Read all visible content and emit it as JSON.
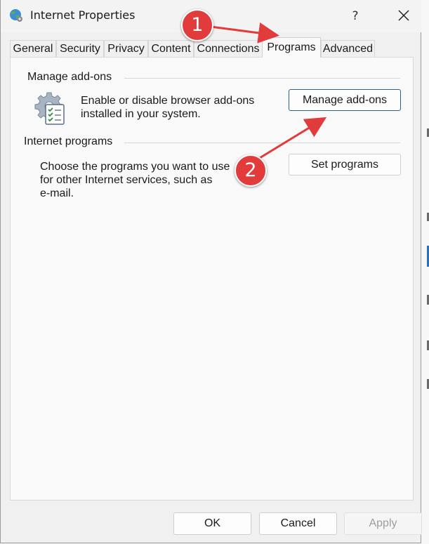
{
  "window": {
    "title": "Internet Properties",
    "help_label": "?",
    "icons": {
      "app": "globe-settings-icon",
      "close": "close-icon"
    }
  },
  "tabs": [
    {
      "label": "General",
      "active": false
    },
    {
      "label": "Security",
      "active": false
    },
    {
      "label": "Privacy",
      "active": false
    },
    {
      "label": "Content",
      "active": false
    },
    {
      "label": "Connections",
      "active": false
    },
    {
      "label": "Programs",
      "active": true
    },
    {
      "label": "Advanced",
      "active": false
    }
  ],
  "manage_addons": {
    "group_label": "Manage add-ons",
    "description_line1": "Enable or disable browser add-ons",
    "description_line2": "installed in your system.",
    "button_label": "Manage add-ons",
    "icon": "addons-gear-checklist-icon"
  },
  "internet_programs": {
    "group_label": "Internet programs",
    "description_line1": "Choose the programs you want to use",
    "description_line2": "for other Internet services, such as",
    "description_line3": "e-mail.",
    "button_label": "Set programs"
  },
  "footer": {
    "ok_label": "OK",
    "cancel_label": "Cancel",
    "apply_label": "Apply"
  },
  "annotations": [
    {
      "label": "1"
    },
    {
      "label": "2"
    }
  ],
  "colors": {
    "marker_red": "#e23b3b",
    "focus_border": "#2d5f8a"
  }
}
